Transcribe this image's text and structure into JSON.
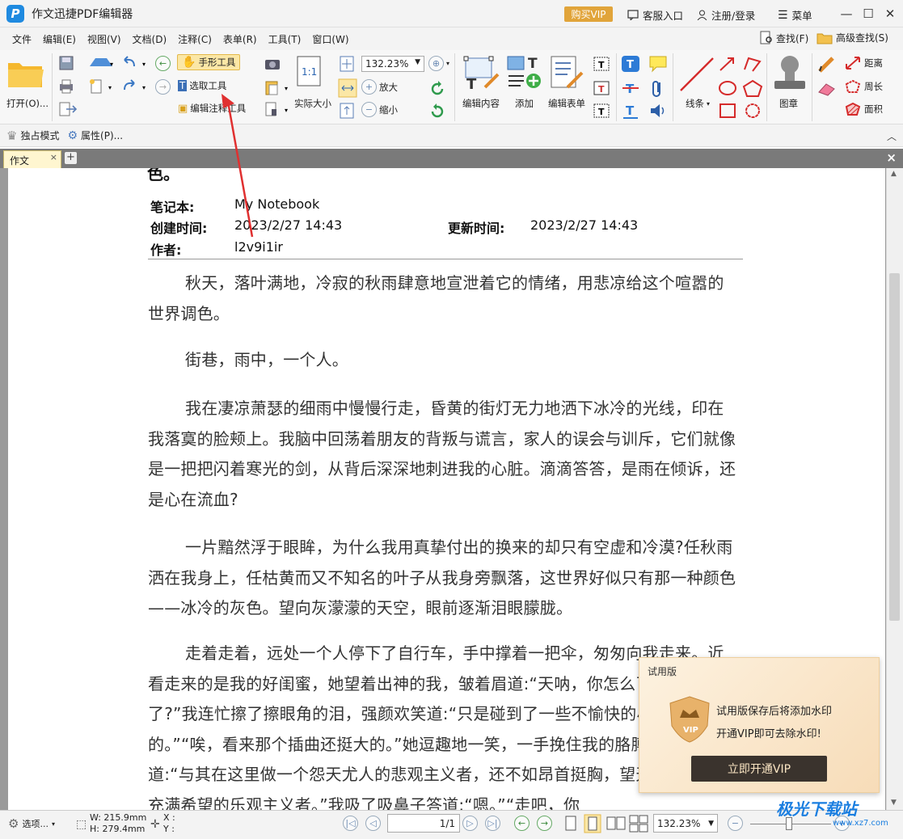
{
  "app": {
    "title": "作文迅捷PDF编辑器",
    "vip": "购买VIP",
    "service": "客服入口",
    "login": "注册/登录",
    "menu": "菜单"
  },
  "menubar": {
    "items": [
      "文件",
      "编辑(E)",
      "视图(V)",
      "文档(D)",
      "注释(C)",
      "表单(R)",
      "工具(T)",
      "窗口(W)"
    ],
    "find": "查找(F)",
    "advfind": "高级查找(S)"
  },
  "ribbon": {
    "open": "打开(O)...",
    "hand": "手形工具",
    "select": "选取工具",
    "edit_annot": "编辑注释工具",
    "actual": "实际大小",
    "zoom": "132.23%",
    "zoomin": "放大",
    "zoomout": "缩小",
    "edit_content": "编辑内容",
    "add": "添加",
    "edit_form": "编辑表单",
    "line": "线条",
    "stamp": "图章",
    "distance": "距离",
    "perimeter": "周长",
    "area": "面积"
  },
  "subbar": {
    "exclusive": "独占模式",
    "props": "属性(P)..."
  },
  "tab": {
    "name": "作文"
  },
  "doc": {
    "top_cut": "色。",
    "notebook_label": "笔记本:",
    "notebook": "My Notebook",
    "created_label": "创建时间:",
    "created": "2023/2/27 14:43",
    "updated_label": "更新时间:",
    "updated": "2023/2/27 14:43",
    "author_label": "作者:",
    "author": "l2v9i1ir",
    "p1": "秋天，落叶满地，冷寂的秋雨肆意地宣泄着它的情绪，用悲凉给这个喧嚣的世界调色。",
    "p2": "街巷，雨中，一个人。",
    "p3": "我在凄凉萧瑟的细雨中慢慢行走，昏黄的街灯无力地洒下冰冷的光线，印在我落寞的脸颊上。我脑中回荡着朋友的背叛与谎言，家人的误会与训斥，它们就像是一把把闪着寒光的剑，从背后深深地刺进我的心脏。滴滴答答，是雨在倾诉，还是心在流血?",
    "p4": "一片黯然浮于眼眸，为什么我用真挚付出的换来的却只有空虚和冷漠?任秋雨洒在我身上，任枯黄而又不知名的叶子从我身旁飘落，这世界好似只有那一种颜色——冰冷的灰色。望向灰濛濛的天空，眼前逐渐泪眼朦胧。",
    "p5": "走着走着，远处一个人停下了自行车，手中撑着一把伞，匆匆向我走来。近看走来的是我的好闺蜜，她望着出神的我，皱着眉道:“天呐，你怎么了?谁欺负你了?”我连忙擦了擦眼角的泪，强颜欢笑道:“只是碰到了一些不愉快的小插曲，没事的。”“唉，看来那个插曲还挺大的。”她逗趣地一笑，一手挽住我的胳膊，淡淡说道:“与其在这里做一个怨天尤人的悲观主义者，还不如昂首挺胸，望天空，对未来充满希望的乐观主义者。”我吸了吸鼻子答道:“嗯。”“走吧，你"
  },
  "trial": {
    "title": "试用版",
    "line1": "试用版保存后将添加水印",
    "line2": "开通VIP即可去除水印!",
    "button": "立即开通VIP"
  },
  "status": {
    "options": "选项...",
    "width": "W: 215.9mm",
    "height": "H: 279.4mm",
    "x": "X :",
    "y": "Y :",
    "page": "1/1",
    "zoom": "132.23%"
  },
  "watermark": {
    "brand": "极光下载站",
    "url": "www.xz7.com"
  }
}
